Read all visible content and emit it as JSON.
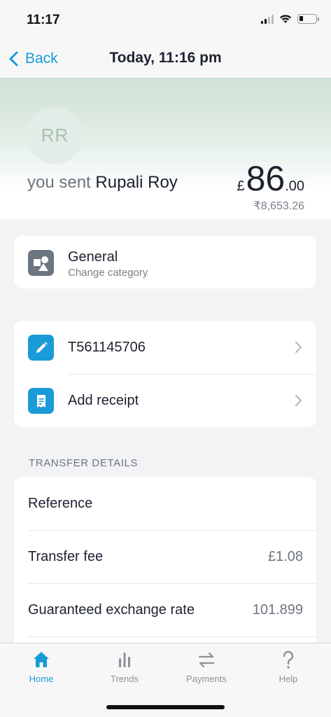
{
  "status_bar": {
    "time": "11:17"
  },
  "nav": {
    "back_label": "Back",
    "title": "Today, 11:16 pm"
  },
  "header": {
    "avatar_initials": "RR",
    "sent_prefix": "you sent",
    "recipient_name": "Rupali Roy",
    "amount_currency": "£",
    "amount_major": "86",
    "amount_minor": ".00",
    "amount_converted": "₹8,653.26"
  },
  "category": {
    "title": "General",
    "subtitle": "Change category"
  },
  "actions": [
    {
      "label": "T561145706",
      "icon": "pencil-icon"
    },
    {
      "label": "Add receipt",
      "icon": "receipt-icon"
    }
  ],
  "transfer_details": {
    "section_title": "TRANSFER DETAILS",
    "rows": [
      {
        "label": "Reference",
        "value": ""
      },
      {
        "label": "Transfer fee",
        "value": "£1.08"
      },
      {
        "label": "Guaranteed exchange rate",
        "value": "101.899"
      }
    ]
  },
  "tabs": [
    {
      "label": "Home",
      "icon": "home-icon",
      "active": true
    },
    {
      "label": "Trends",
      "icon": "bar-chart-icon",
      "active": false
    },
    {
      "label": "Payments",
      "icon": "transfer-arrows-icon",
      "active": false
    },
    {
      "label": "Help",
      "icon": "question-icon",
      "active": false
    }
  ],
  "colors": {
    "accent": "#1a9bd7",
    "category_icon_bg": "#6c7582",
    "hero_tint": "#cfe1d6"
  }
}
